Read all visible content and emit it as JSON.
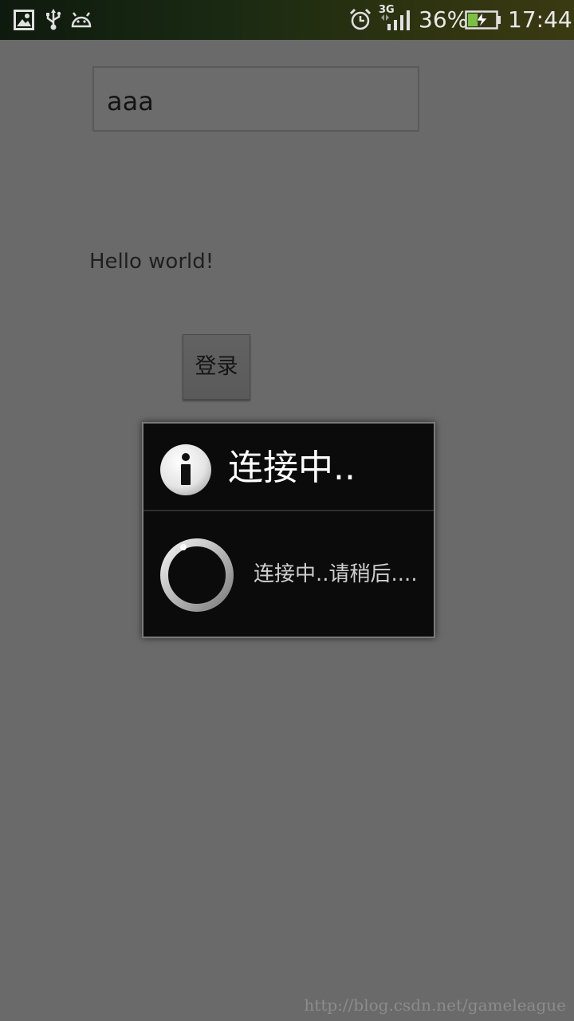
{
  "status_bar": {
    "battery_percent": "36%",
    "network_type": "3G",
    "time": "17:44",
    "battery_level": 0.36,
    "left_icons": [
      "gallery-icon",
      "usb-icon",
      "android-debug-icon"
    ],
    "right_icons": [
      "alarm-icon",
      "signal-icon",
      "battery-charging-icon"
    ]
  },
  "form": {
    "input_value": "aaa",
    "hello_text": "Hello world!",
    "login_label": "登录"
  },
  "dialog": {
    "title": "连接中..",
    "message": "连接中..请稍后....",
    "icon": "info-icon"
  },
  "watermark": "http://blog.csdn.net/gameleague",
  "colors": {
    "background": "#6a6a6a",
    "dialog_bg": "#0b0b0b",
    "battery_fill": "#7bc043"
  }
}
